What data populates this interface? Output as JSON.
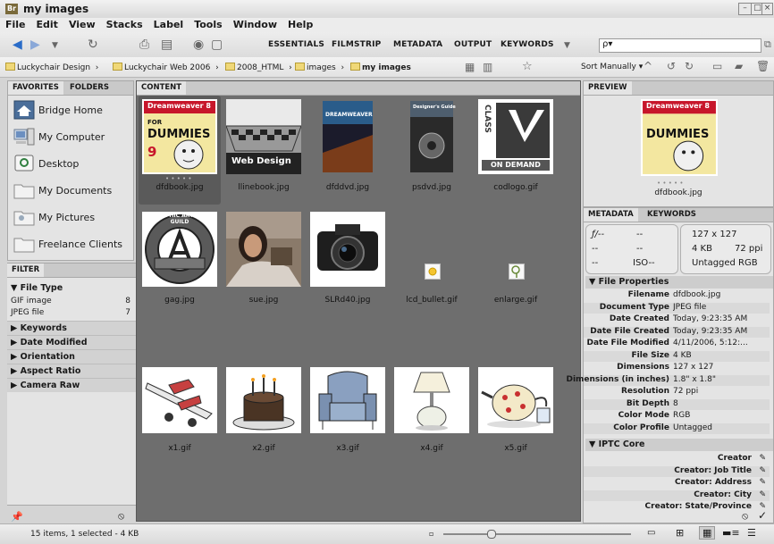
{
  "window": {
    "title": "my images",
    "app_icon": "Br"
  },
  "menu": [
    "File",
    "Edit",
    "View",
    "Stacks",
    "Label",
    "Tools",
    "Window",
    "Help"
  ],
  "workspaces": [
    "ESSENTIALS",
    "FILMSTRIP",
    "METADATA",
    "OUTPUT",
    "KEYWORDS"
  ],
  "search": {
    "placeholder": "",
    "prefix": "ρ▾"
  },
  "breadcrumb": [
    "Luckychair Design",
    "Luckychair Web 2006",
    "2008_HTML",
    "images",
    "my images"
  ],
  "sort": {
    "label": "Sort Manually ▾"
  },
  "left": {
    "tabs": [
      "FAVORITES",
      "FOLDERS"
    ],
    "favorites": [
      "Bridge Home",
      "My Computer",
      "Desktop",
      "My Documents",
      "My Pictures",
      "Freelance Clients"
    ],
    "filter_tab": "FILTER",
    "file_type_head": "▼ File Type",
    "file_types": [
      {
        "label": "GIF image",
        "count": "8"
      },
      {
        "label": "JPEG file",
        "count": "7"
      }
    ],
    "sections": [
      "▶ Keywords",
      "▶ Date Modified",
      "▶ Orientation",
      "▶ Aspect Ratio",
      "▶ Camera Raw"
    ]
  },
  "content": {
    "tab": "CONTENT",
    "items": [
      {
        "name": "dfdbook.jpg",
        "thumb": "dummies-book"
      },
      {
        "name": "llinebook.jpg",
        "thumb": "web-design-book"
      },
      {
        "name": "dfddvd.jpg",
        "thumb": "dreamweaver-dvd"
      },
      {
        "name": "psdvd.jpg",
        "thumb": "photoshop-dvd"
      },
      {
        "name": "codlogo.gif",
        "thumb": "class-on-demand-logo"
      },
      {
        "name": "gag.jpg",
        "thumb": "graphic-artists-guild-seal"
      },
      {
        "name": "sue.jpg",
        "thumb": "photo-woman"
      },
      {
        "name": "SLRd40.jpg",
        "thumb": "camera"
      },
      {
        "name": "lcd_bullet.gif",
        "thumb": "small-bullet"
      },
      {
        "name": "enlarge.gif",
        "thumb": "small-enlarge"
      },
      {
        "name": "x1.gif",
        "thumb": "airplane-clipart"
      },
      {
        "name": "x2.gif",
        "thumb": "cake-clipart"
      },
      {
        "name": "x3.gif",
        "thumb": "armchair-clipart"
      },
      {
        "name": "x4.gif",
        "thumb": "lamp-clipart"
      },
      {
        "name": "x5.gif",
        "thumb": "teapot-clipart"
      }
    ],
    "selected_index": 0,
    "dummies_text": {
      "line1": "Dreamweaver 8",
      "line2": "DUMMIES",
      "line3": "9",
      "for": "FOR",
      "dots": "• • • • •"
    },
    "webdesign_text": "Web Design",
    "dvd_text": "DREAMWEAVER",
    "psdvd_text": "Designer's Guide",
    "class_text": {
      "vertical": "CLASS",
      "bottom": "ON DEMAND"
    },
    "gag_text": "GRAPHIC ARTISTS GUILD"
  },
  "preview": {
    "tab": "PREVIEW",
    "filename": "dfdbook.jpg",
    "dots": "• • • • •"
  },
  "metadata": {
    "tabs": [
      "METADATA",
      "KEYWORDS"
    ],
    "camera": {
      "fstop": "ƒ/--",
      "shutter": "--",
      "exp": "--",
      "wb": "--",
      "iso_label": "--",
      "iso": "ISO--"
    },
    "summary": {
      "dims": "127 x 127",
      "size": "4 KB",
      "ppi": "72 ppi",
      "tag": "Untagged",
      "mode": "RGB"
    },
    "file_properties_head": "▼ File Properties",
    "file_properties": [
      {
        "k": "Filename",
        "v": "dfdbook.jpg"
      },
      {
        "k": "Document Type",
        "v": "JPEG file"
      },
      {
        "k": "Date Created",
        "v": "Today, 9:23:35 AM"
      },
      {
        "k": "Date File Created",
        "v": "Today, 9:23:35 AM"
      },
      {
        "k": "Date File Modified",
        "v": "4/11/2006, 5:12:..."
      },
      {
        "k": "File Size",
        "v": "4 KB"
      },
      {
        "k": "Dimensions",
        "v": "127 x 127"
      },
      {
        "k": "Dimensions (in inches)",
        "v": "1.8\" x 1.8\""
      },
      {
        "k": "Resolution",
        "v": "72 ppi"
      },
      {
        "k": "Bit Depth",
        "v": "8"
      },
      {
        "k": "Color Mode",
        "v": "RGB"
      },
      {
        "k": "Color Profile",
        "v": "Untagged"
      }
    ],
    "iptc_head": "▼ IPTC Core",
    "iptc": [
      "Creator",
      "Creator: Job Title",
      "Creator: Address",
      "Creator: City",
      "Creator: State/Province"
    ]
  },
  "status": {
    "text": "15 items, 1 selected - 4 KB",
    "zoom": 0.25
  },
  "colors": {
    "content_bg": "#6e6e6e",
    "panel_bg": "#e4e4e4",
    "selected": "#5a5a5a"
  }
}
